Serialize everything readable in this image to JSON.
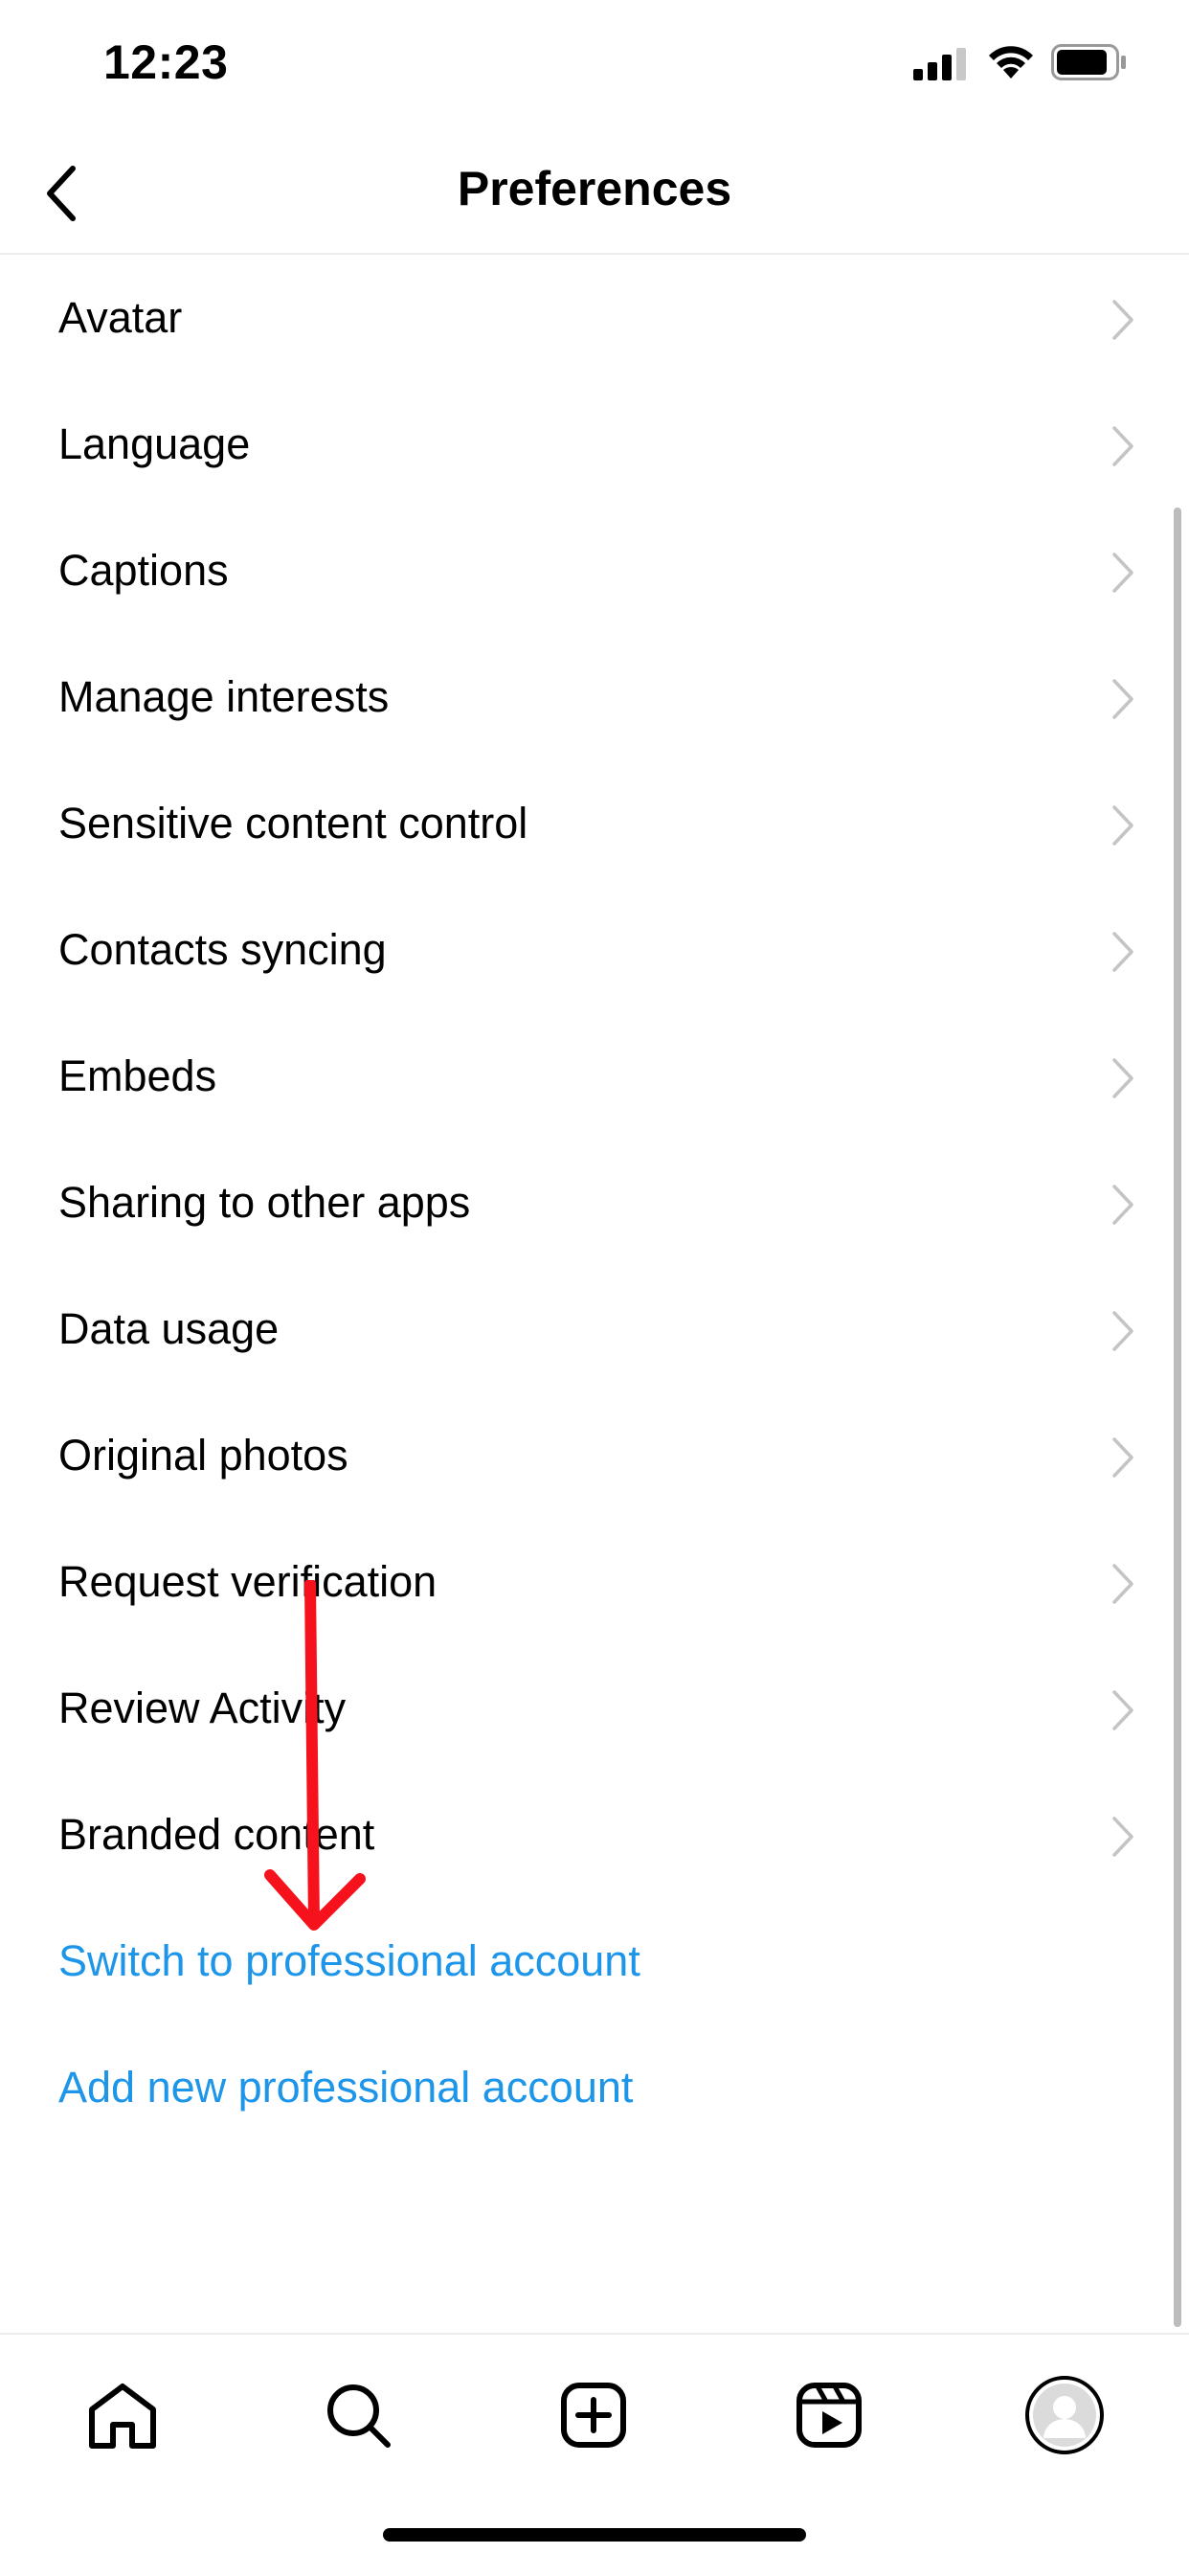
{
  "status_bar": {
    "time": "12:23"
  },
  "header": {
    "title": "Preferences",
    "back_icon": "chevron-left-icon"
  },
  "settings_items": [
    {
      "label": "Avatar"
    },
    {
      "label": "Language"
    },
    {
      "label": "Captions"
    },
    {
      "label": "Manage interests"
    },
    {
      "label": "Sensitive content control"
    },
    {
      "label": "Contacts syncing"
    },
    {
      "label": "Embeds"
    },
    {
      "label": "Sharing to other apps"
    },
    {
      "label": "Data usage"
    },
    {
      "label": "Original photos"
    },
    {
      "label": "Request verification"
    },
    {
      "label": "Review Activity"
    },
    {
      "label": "Branded content"
    }
  ],
  "links": {
    "switch_professional": "Switch to professional account",
    "add_professional": "Add new professional account"
  },
  "colors": {
    "link": "#1d95e9",
    "annotation": "#f5121c",
    "chevron": "#c4c4c4"
  },
  "tab_bar": {
    "icons": [
      "home-icon",
      "search-icon",
      "create-icon",
      "reels-icon",
      "profile-avatar"
    ]
  }
}
